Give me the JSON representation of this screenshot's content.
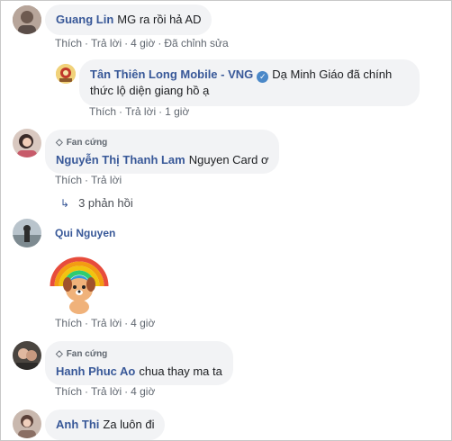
{
  "ui": {
    "like": "Thích",
    "reply": "Trả lời",
    "dot": "·",
    "fan_badge": "Fan cứng"
  },
  "comments": [
    {
      "author": "Guang Lin",
      "text": "MG ra rồi hả AD",
      "time": "4 giờ",
      "edited": "Đã chỉnh sửa"
    },
    {
      "author": "Tân Thiên Long Mobile - VNG",
      "text": "Dạ Minh Giáo đã chính thức lộ diện giang hồ ạ",
      "time": "1 giờ"
    },
    {
      "author": "Nguyễn Thị Thanh Lam",
      "text": "Nguyen Card ơ",
      "replies": "3 phản hồi"
    },
    {
      "author": "Qui Nguyen",
      "time": "4 giờ",
      "sticker": "rainbow-dog-sticker"
    },
    {
      "author": "Hanh Phuc Ao",
      "text": "chua thay ma ta",
      "time": "4 giờ"
    },
    {
      "author": "Anh Thi",
      "text": "Za luôn đi"
    }
  ],
  "colors": {
    "name": "#385898",
    "bubble": "#f2f3f5",
    "meta": "#606770",
    "verified": "#4b88c8"
  }
}
